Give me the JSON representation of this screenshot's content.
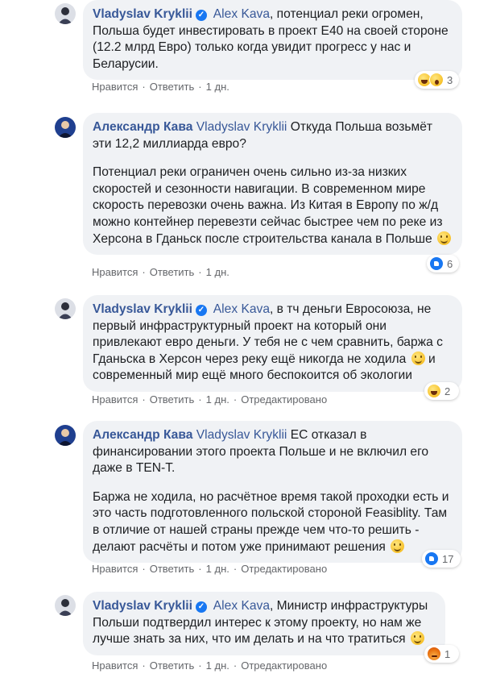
{
  "comments": [
    {
      "author": "Vladyslav Kryklii",
      "verified": true,
      "paragraphs": [
        {
          "mention": "Alex Kava",
          "text": ", потенциал реки огромен, Польша будет инвестировать в проект E40 на своей стороне (12.2 млрд Евро) только когда увидит прогресс у нас и Беларусии."
        }
      ],
      "reactions": {
        "icons": [
          "haha",
          "wow"
        ],
        "count": "3"
      },
      "actions": {
        "like": "Нравится",
        "reply": "Ответить",
        "time": "1 дн.",
        "edited": ""
      }
    },
    {
      "author": "Александр Кава",
      "verified": false,
      "paragraphs": [
        {
          "mention": "Vladyslav Kryklii",
          "text": " Откуда Польша возьмёт эти 12,2 миллиарда евро?"
        },
        {
          "mention": "",
          "text": "Потенциал реки ограничен очень сильно из-за низких скоростей и сезонности навигации. В современном мире скорость перевозки очень важна. Из Китая в Европу по ж/д можно контейнер перевезти сейчас быстрее чем по реке из Херсона в Гданьск после строительства канала в Польше ",
          "emoji": true
        }
      ],
      "reactions": {
        "icons": [
          "like"
        ],
        "count": "6"
      },
      "actions": {
        "like": "Нравится",
        "reply": "Ответить",
        "time": "1 дн.",
        "edited": ""
      }
    },
    {
      "author": "Vladyslav Kryklii",
      "verified": true,
      "paragraphs": [
        {
          "mention": "Alex Kava",
          "text": ", в тч деньги Евросоюза, не первый инфраструктурный проект на который они привлекают евро деньги. У тебя не с чем сравнить, баржа с Гданьска в Херсон через реку ещё никогда не ходила ",
          "emoji": true,
          "tail": " и современный мир ещё много беспокоится об экологии"
        }
      ],
      "reactions": {
        "icons": [
          "haha"
        ],
        "count": "2"
      },
      "actions": {
        "like": "Нравится",
        "reply": "Ответить",
        "time": "1 дн.",
        "edited": "Отредактировано"
      }
    },
    {
      "author": "Александр Кава",
      "verified": false,
      "paragraphs": [
        {
          "mention": "Vladyslav Kryklii",
          "text": " ЕС отказал в финансировании этого проекта Польше и не включил его даже в TEN-T."
        },
        {
          "mention": "",
          "text": "Баржа не ходила, но расчётное время такой проходки есть и это часть подготовленного польской стороной Feasiblity. Там в отличие от нашей страны прежде чем что-то решить - делают расчёты и потом уже принимают решения ",
          "emoji": true
        }
      ],
      "reactions": {
        "icons": [
          "like"
        ],
        "count": "17"
      },
      "actions": {
        "like": "Нравится",
        "reply": "Ответить",
        "time": "1 дн.",
        "edited": "Отредактировано"
      }
    },
    {
      "author": "Vladyslav Kryklii",
      "verified": true,
      "paragraphs": [
        {
          "mention": "Alex Kava",
          "text": ", Министр инфраструктуры Польши подтвердил интерес к этому проекту, но нам же лучше знать за них, что им делать и на что тратиться ",
          "emoji": true
        }
      ],
      "reactions": {
        "icons": [
          "angry"
        ],
        "count": "1"
      },
      "actions": {
        "like": "Нравится",
        "reply": "Ответить",
        "time": "1 дн.",
        "edited": "Отредактировано"
      }
    }
  ],
  "colors": {
    "name": "#385898",
    "bubble": "#f0f2f5",
    "meta": "#65676b",
    "verified": "#1877f2"
  }
}
